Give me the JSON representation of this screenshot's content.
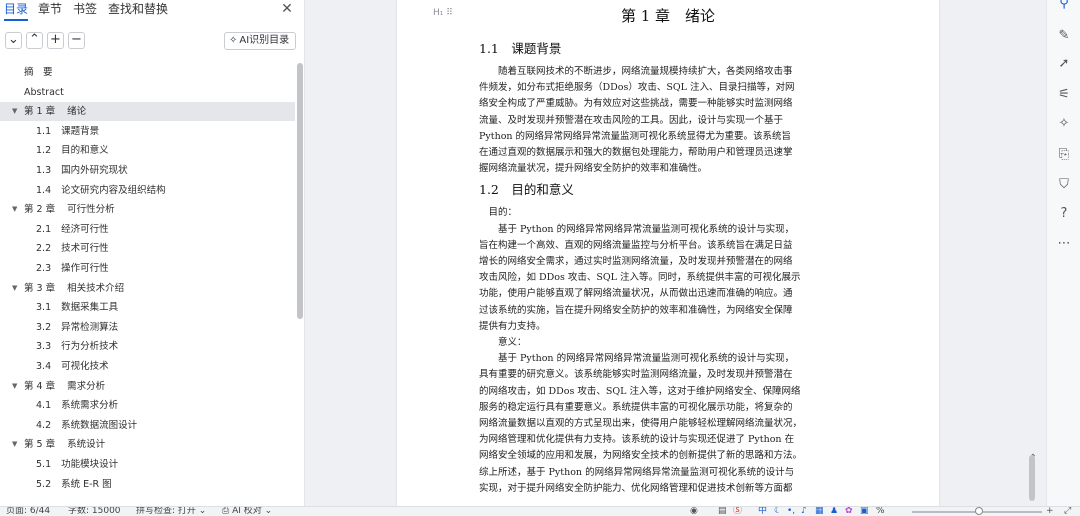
{
  "nav": {
    "tabs": [
      {
        "label": "目录",
        "active": true
      },
      {
        "label": "章节",
        "active": false
      },
      {
        "label": "书签",
        "active": false
      },
      {
        "label": "查找和替换",
        "active": false
      }
    ],
    "close_icon": "close-icon",
    "toolbar": {
      "collapse": "⌄",
      "expand": "⌃",
      "add": "+",
      "remove": "−",
      "ai_toc_label": "AI识别目录"
    },
    "toc": [
      {
        "num": "",
        "text": "摘　要",
        "level": 1,
        "caret": false
      },
      {
        "num": "",
        "text": "Abstract",
        "level": 1,
        "caret": false
      },
      {
        "num": "第 1 章",
        "text": "绪论",
        "level": 1,
        "caret": true,
        "selected": true
      },
      {
        "num": "1.1",
        "text": "课题背景",
        "level": 2
      },
      {
        "num": "1.2",
        "text": "目的和意义",
        "level": 2
      },
      {
        "num": "1.3",
        "text": "国内外研究现状",
        "level": 2
      },
      {
        "num": "1.4",
        "text": "论文研究内容及组织结构",
        "level": 2
      },
      {
        "num": "第 2 章",
        "text": "可行性分析",
        "level": 1,
        "caret": true
      },
      {
        "num": "2.1",
        "text": "经济可行性",
        "level": 2
      },
      {
        "num": "2.2",
        "text": "技术可行性",
        "level": 2
      },
      {
        "num": "2.3",
        "text": "操作可行性",
        "level": 2
      },
      {
        "num": "第 3 章",
        "text": "相关技术介绍",
        "level": 1,
        "caret": true
      },
      {
        "num": "3.1",
        "text": "数据采集工具",
        "level": 2
      },
      {
        "num": "3.2",
        "text": "异常检测算法",
        "level": 2
      },
      {
        "num": "3.3",
        "text": "行为分析技术",
        "level": 2
      },
      {
        "num": "3.4",
        "text": "可视化技术",
        "level": 2
      },
      {
        "num": "第 4 章",
        "text": "需求分析",
        "level": 1,
        "caret": true
      },
      {
        "num": "4.1",
        "text": "系统需求分析",
        "level": 2
      },
      {
        "num": "4.2",
        "text": "系统数据流图设计",
        "level": 2
      },
      {
        "num": "第 5 章",
        "text": "系统设计",
        "level": 1,
        "caret": true
      },
      {
        "num": "5.1",
        "text": "功能模块设计",
        "level": 2
      },
      {
        "num": "5.2",
        "text": "系统 E-R 图",
        "level": 2
      }
    ]
  },
  "document": {
    "heading_marker": "H₁ ⠿",
    "chapter_title": "第 1 章　绪论",
    "sections": [
      {
        "title": "1.1　课题背景",
        "lines": [
          "　　随着互联网技术的不断进步，网络流量规模持续扩大，各类网络攻击事",
          "件频发，如分布式拒绝服务（DDos）攻击、SQL 注入、目录扫描等，对网",
          "络安全构成了严重威胁。为有效应对这些挑战，需要一种能够实时监测网络",
          "流量、及时发现并预警潜在攻击风险的工具。因此，设计与实现一个基于",
          "Python 的网络异常网络异常流量监测可视化系统显得尤为重要。该系统旨",
          "在通过直观的数据展示和强大的数据包处理能力，帮助用户和管理员迅速掌",
          "握网络流量状况，提升网络安全防护的效率和准确性。"
        ]
      },
      {
        "title": "1.2　目的和意义",
        "lines": [
          "　目的：",
          "　　基于 Python 的网络异常网络异常流量监测可视化系统的设计与实现，",
          "旨在构建一个高效、直观的网络流量监控与分析平台。该系统旨在满足日益",
          "增长的网络安全需求，通过实时监测网络流量，及时发现并预警潜在的网络",
          "攻击风险，如 DDos 攻击、SQL 注入等。同时，系统提供丰富的可视化展示",
          "功能，使用户能够直观了解网络流量状况，从而做出迅速而准确的响应。通",
          "过该系统的实施，旨在提升网络安全防护的效率和准确性，为网络安全保障",
          "提供有力支持。",
          "　　意义：",
          "　　基于 Python 的网络异常网络异常流量监测可视化系统的设计与实现，",
          "具有重要的研究意义。该系统能够实时监测网络流量，及时发现并预警潜在",
          "的网络攻击，如 DDos 攻击、SQL 注入等，这对于维护网络安全、保障网络",
          "服务的稳定运行具有重要意义。系统提供丰富的可视化展示功能，将复杂的",
          "网络流量数据以直观的方式呈现出来，使得用户能够轻松理解网络流量状况，",
          "为网络管理和优化提供有力支持。该系统的设计与实现还促进了 Python 在",
          "网络安全领域的应用和发展，为网络安全技术的创新提供了新的思路和方法。",
          "综上所述，基于 Python 的网络异常网络异常流量监测可视化系统的设计与",
          "实现，对于提升网络安全防护能力、优化网络管理和促进技术创新等方面都"
        ]
      }
    ]
  },
  "right_rail": {
    "icons": [
      "location-icon",
      "pen-icon",
      "select-cursor-icon",
      "adjust-icon",
      "magic-icon",
      "translate-icon",
      "shirt-icon",
      "help-icon",
      "more-icon"
    ]
  },
  "status_bar": {
    "page": "页面: 6/44",
    "word_count": "字数: 15000",
    "spell_check": "拼写检查: 打开 ⌄",
    "ai_check": "AI 校对 ⌄",
    "zoom": "%"
  },
  "colors": {
    "accent": "#1a5fd0",
    "selected_row": "#e4e6ea"
  }
}
